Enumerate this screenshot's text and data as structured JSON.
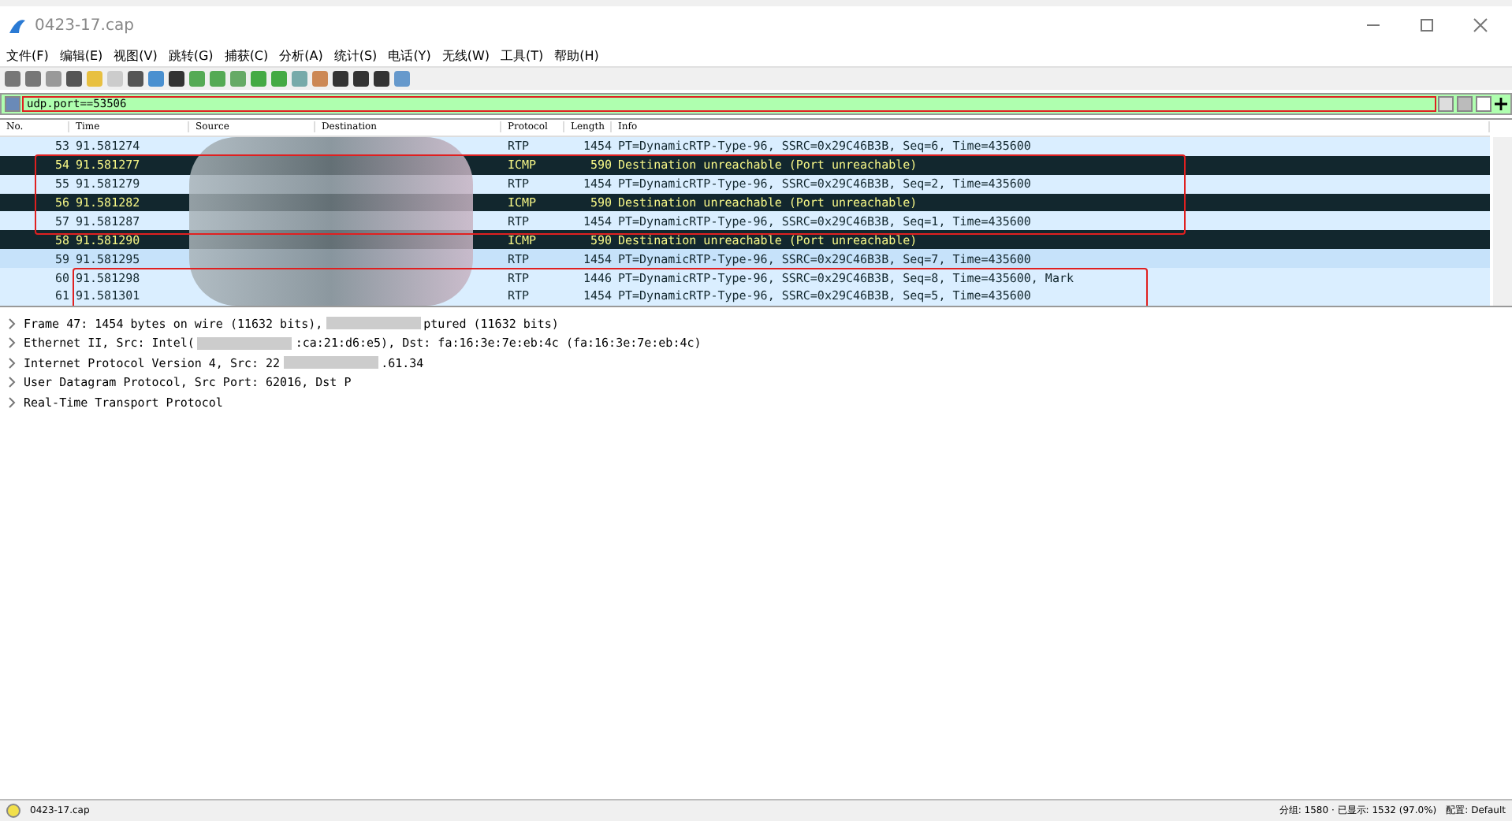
{
  "window": {
    "title": "0423-17.cap"
  },
  "menu": [
    "文件(F)",
    "编辑(E)",
    "视图(V)",
    "跳转(G)",
    "捕获(C)",
    "分析(A)",
    "统计(S)",
    "电话(Y)",
    "无线(W)",
    "工具(T)",
    "帮助(H)"
  ],
  "filter": {
    "value": "udp.port==53506"
  },
  "columns": [
    "No.",
    "Time",
    "Source",
    "Destination",
    "Protocol",
    "Length",
    "Info"
  ],
  "rows": [
    {
      "no": "53",
      "time": "91.581274",
      "protocol": "RTP",
      "length": "1454",
      "info": "PT=DynamicRTP-Type-96, SSRC=0x29C46B3B, Seq=6, Time=435600",
      "kind": "rtp",
      "selected": false,
      "boxed": false
    },
    {
      "no": "54",
      "time": "91.581277",
      "protocol": "ICMP",
      "length": "590",
      "info": "Destination unreachable (Port unreachable)",
      "kind": "icmp",
      "selected": false,
      "boxed": true
    },
    {
      "no": "55",
      "time": "91.581279",
      "protocol": "RTP",
      "length": "1454",
      "info": "PT=DynamicRTP-Type-96, SSRC=0x29C46B3B, Seq=2, Time=435600",
      "kind": "rtp",
      "selected": false,
      "boxed": true
    },
    {
      "no": "56",
      "time": "91.581282",
      "protocol": "ICMP",
      "length": "590",
      "info": "Destination unreachable (Port unreachable)",
      "kind": "icmp",
      "selected": false,
      "boxed": true
    },
    {
      "no": "57",
      "time": "91.581287",
      "protocol": "RTP",
      "length": "1454",
      "info": "PT=DynamicRTP-Type-96, SSRC=0x29C46B3B, Seq=1, Time=435600",
      "kind": "rtp",
      "selected": false,
      "boxed": true
    },
    {
      "no": "58",
      "time": "91.581290",
      "protocol": "ICMP",
      "length": "590",
      "info": "Destination unreachable (Port unreachable)",
      "kind": "icmp",
      "selected": false,
      "boxed": false
    },
    {
      "no": "59",
      "time": "91.581295",
      "protocol": "RTP",
      "length": "1454",
      "info": "PT=DynamicRTP-Type-96, SSRC=0x29C46B3B, Seq=7, Time=435600",
      "kind": "rtp",
      "selected": true,
      "boxed": false
    },
    {
      "no": "60",
      "time": "91.581298",
      "protocol": "RTP",
      "length": "1446",
      "info": "PT=DynamicRTP-Type-96, SSRC=0x29C46B3B, Seq=8, Time=435600, Mark",
      "kind": "rtp",
      "selected": false,
      "boxed": true
    },
    {
      "no": "61",
      "time": "91.581301",
      "protocol": "RTP",
      "length": "1454",
      "info": "PT=DynamicRTP-Type-96, SSRC=0x29C46B3B, Seq=5, Time=435600",
      "kind": "rtp",
      "selected": false,
      "boxed": true
    }
  ],
  "details": [
    {
      "parts": [
        "Frame 47: 1454 bytes on wire (11632 bits),",
        "ptured (11632 bits)"
      ],
      "expanded": false
    },
    {
      "parts": [
        "Ethernet II, Src: Intel(",
        ":ca:21:d6:e5), Dst: fa:16:3e:7e:eb:4c (fa:16:3e:7e:eb:4c)"
      ],
      "expanded": false
    },
    {
      "parts": [
        "Internet Protocol Version 4, Src: 22",
        ".61.34"
      ],
      "expanded": false
    },
    {
      "parts": [
        "User Datagram Protocol, Src Port: 62016, Dst P"
      ],
      "expanded": false
    },
    {
      "parts": [
        "Real-Time Transport Protocol"
      ],
      "expanded": false
    }
  ],
  "status": {
    "file": "0423-17.cap",
    "packets": "分组: 1580 · 已显示: 1532 (97.0%)",
    "profile": "配置: Default"
  }
}
